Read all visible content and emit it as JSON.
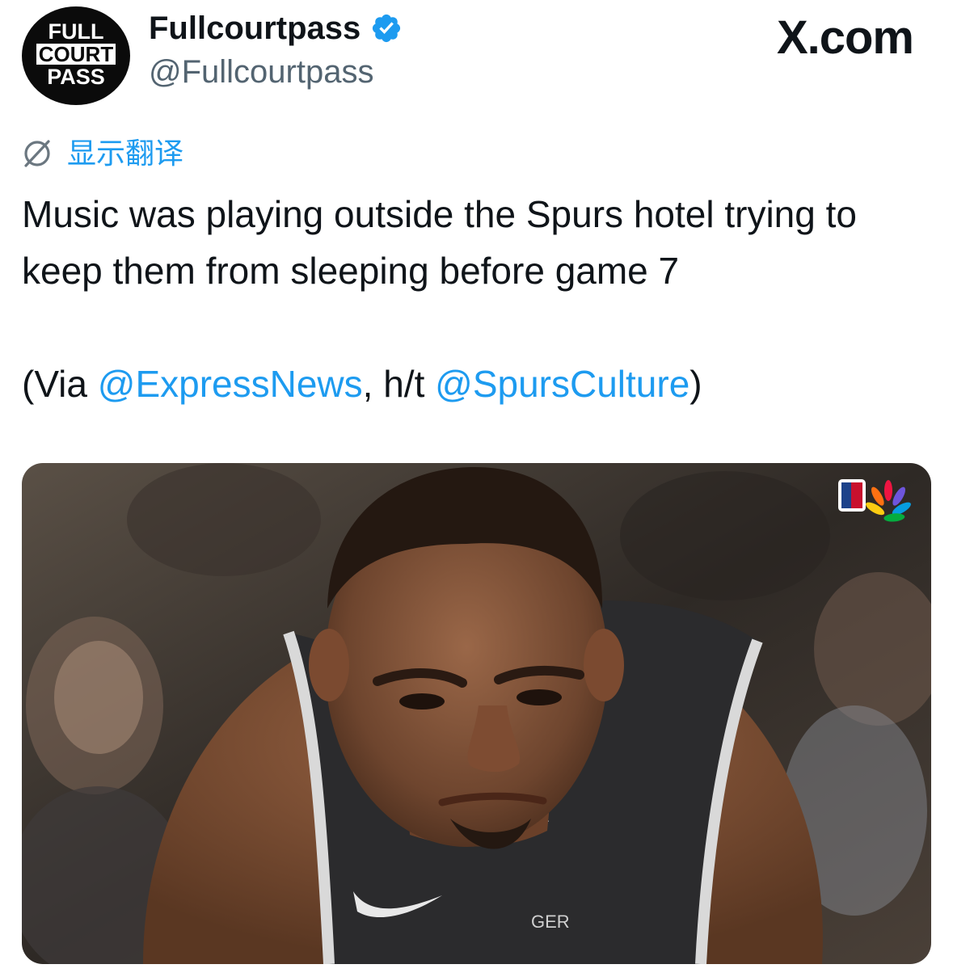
{
  "author": {
    "display_name": "Fullcourtpass",
    "handle": "@Fullcourtpass",
    "verified": true,
    "avatar_logo_lines": [
      "FULL",
      "COURT",
      "PASS"
    ]
  },
  "brand": "X.com",
  "translate_label": "显示翻译",
  "tweet": {
    "line1": "Music was playing outside the Spurs hotel trying to keep them from sleeping before game 7",
    "via_open": "(Via ",
    "mention1": "@ExpressNews",
    "middle": ", h/t ",
    "mention2": "@SpursCulture",
    "via_close": ")"
  },
  "media": {
    "jersey_text": "GER",
    "broadcast_logos": [
      "NBA",
      "NBC"
    ]
  },
  "colors": {
    "link": "#1d9bf0",
    "text": "#0f1419",
    "secondary": "#536471",
    "verified_badge": "#1d9bf0"
  },
  "icons": [
    "verified-badge-icon",
    "translate-icon",
    "nba-logo-icon",
    "nbc-peacock-icon"
  ]
}
